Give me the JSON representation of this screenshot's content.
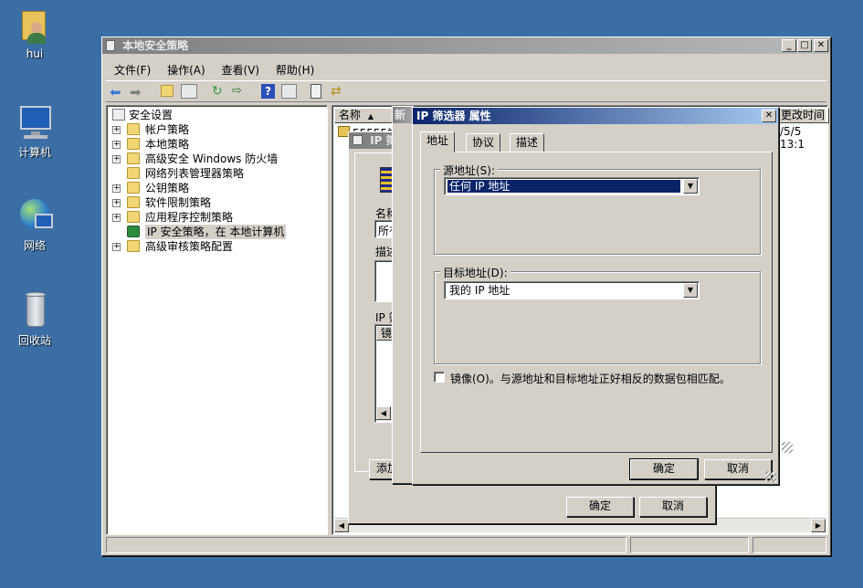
{
  "desktop": {
    "icons": [
      {
        "label": "hui"
      },
      {
        "label": "计算机"
      },
      {
        "label": "网络"
      },
      {
        "label": "回收站"
      }
    ]
  },
  "main_window": {
    "title": "本地安全策略",
    "menu": [
      "文件(F)",
      "操作(A)",
      "查看(V)",
      "帮助(H)"
    ],
    "tree": [
      {
        "label": "安全设置",
        "expand": ""
      },
      {
        "label": "帐户策略",
        "expand": "+"
      },
      {
        "label": "本地策略",
        "expand": "+"
      },
      {
        "label": "高级安全 Windows 防火墙",
        "expand": "+"
      },
      {
        "label": "网络列表管理器策略",
        "expand": ""
      },
      {
        "label": "公钥策略",
        "expand": "+"
      },
      {
        "label": "软件限制策略",
        "expand": "+"
      },
      {
        "label": "应用程序控制策略",
        "expand": "+"
      },
      {
        "label": "IP 安全策略，在 本地计算机",
        "expand": ""
      },
      {
        "label": "高级审核策略配置",
        "expand": "+"
      }
    ],
    "list_headers": {
      "name": "名称",
      "sort": "▲",
      "new_col": "新",
      "modified": "更改时间"
    },
    "list_rows": [
      {
        "name": "55555端",
        "modified": "/5/5 13:1"
      }
    ]
  },
  "back_dialog": {
    "title": "IP 筛",
    "name_label": "名称(N)",
    "name_value": "所有ip",
    "desc_label": "描述(D)",
    "filter_label": "IP 筛选",
    "list_header": "镜像",
    "add_button": "添加",
    "ok_button": "确定",
    "cancel_button": "取消"
  },
  "filter_dialog": {
    "title": "IP 筛选器 属性",
    "tabs": [
      "地址",
      "协议",
      "描述"
    ],
    "source_group": "源地址(S):",
    "source_value": "任何 IP 地址",
    "dest_group": "目标地址(D):",
    "dest_value": "我的 IP 地址",
    "mirror_label": "镜像(O)。与源地址和目标地址正好相反的数据包相匹配。",
    "ok_button": "确定",
    "cancel_button": "取消"
  }
}
